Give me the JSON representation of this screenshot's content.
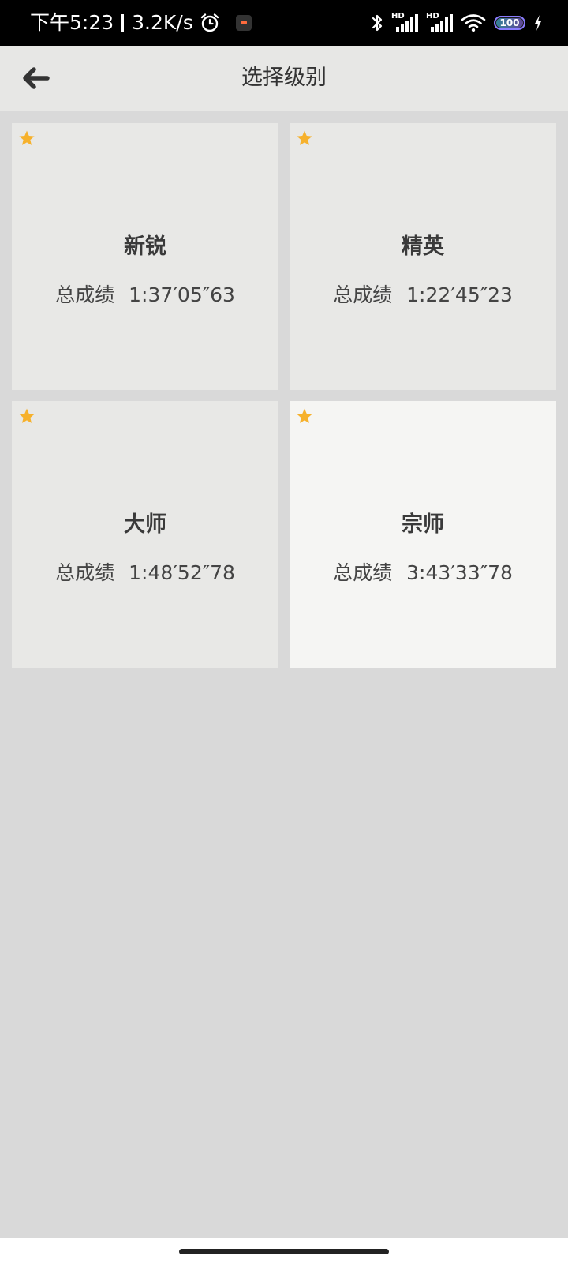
{
  "status_bar": {
    "time": "下午5:23",
    "net_speed": "3.2K/s",
    "signal_label": "HD",
    "battery": "100"
  },
  "header": {
    "title": "选择级别"
  },
  "levels": [
    {
      "name": "新锐",
      "score_label": "总成绩",
      "score": "1:37′05″63"
    },
    {
      "name": "精英",
      "score_label": "总成绩",
      "score": "1:22′45″23"
    },
    {
      "name": "大师",
      "score_label": "总成绩",
      "score": "1:48′52″78"
    },
    {
      "name": "宗师",
      "score_label": "总成绩",
      "score": "3:43′33″78"
    }
  ],
  "colors": {
    "star": "#f6b12c",
    "card": "#e8e8e6",
    "card_selected": "#f5f5f3",
    "background": "#d9d9d9",
    "app_bar": "#e7e7e5"
  }
}
